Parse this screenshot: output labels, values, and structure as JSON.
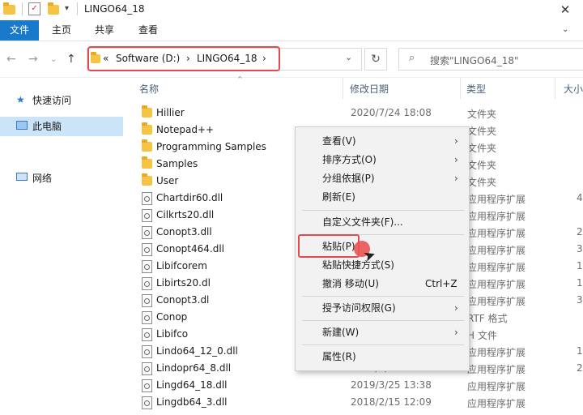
{
  "window": {
    "title": "LINGO64_18",
    "close_glyph": "✕"
  },
  "ribbon": {
    "tabs": [
      "文件",
      "主页",
      "共享",
      "查看"
    ]
  },
  "nav": {
    "back": "←",
    "forward": "→",
    "dropdown": "⌄",
    "up": "↑"
  },
  "address": {
    "prefix": "«",
    "crumbs": [
      "Software (D:)",
      "LINGO64_18"
    ],
    "separator": "›"
  },
  "search": {
    "placeholder": "搜索\"LINGO64_18\""
  },
  "sidebar": {
    "items": [
      {
        "label": "快速访问",
        "icon": "star-icon"
      },
      {
        "label": "此电脑",
        "icon": "computer-icon"
      },
      {
        "label": "网络",
        "icon": "network-icon"
      }
    ]
  },
  "columns": {
    "name": "名称",
    "date": "修改日期",
    "type": "类型",
    "size": "大小"
  },
  "files": [
    {
      "name": "Hillier",
      "date": "2020/7/24 18:08",
      "type": "文件夹",
      "size": "",
      "kind": "folder"
    },
    {
      "name": "Notepad++",
      "date": "",
      "type": "文件夹",
      "size": "",
      "kind": "folder"
    },
    {
      "name": "Programming Samples",
      "date": "",
      "type": "文件夹",
      "size": "",
      "kind": "folder"
    },
    {
      "name": "Samples",
      "date": "",
      "type": "文件夹",
      "size": "",
      "kind": "folder"
    },
    {
      "name": "User",
      "date": "",
      "type": "文件夹",
      "size": "",
      "kind": "folder"
    },
    {
      "name": "Chartdir60.dll",
      "date": "",
      "type": "应用程序扩展",
      "size": "4,",
      "kind": "dll"
    },
    {
      "name": "Cilkrts20.dll",
      "date": "",
      "type": "应用程序扩展",
      "size": "",
      "kind": "dll"
    },
    {
      "name": "Conopt3.dll",
      "date": "",
      "type": "应用程序扩展",
      "size": "2,",
      "kind": "dll"
    },
    {
      "name": "Conopt464.dll",
      "date": "",
      "type": "应用程序扩展",
      "size": "3,",
      "kind": "dll"
    },
    {
      "name": "Libifcorem",
      "date": "",
      "type": "应用程序扩展",
      "size": "1,",
      "kind": "dll"
    },
    {
      "name": "Libirts20.dl",
      "date": "",
      "type": "应用程序扩展",
      "size": "1,",
      "kind": "dll"
    },
    {
      "name": "Conopt3.dl",
      "date": "",
      "type": "应用程序扩展",
      "size": "3,",
      "kind": "dll"
    },
    {
      "name": "Conop",
      "date": "",
      "type": "RTF 格式",
      "size": "",
      "kind": "dll"
    },
    {
      "name": "Libifco",
      "date": "",
      "type": "H 文件",
      "size": "",
      "kind": "dll"
    },
    {
      "name": "Lindo64_12_0.dll",
      "date": "",
      "type": "应用程序扩展",
      "size": "14,",
      "kind": "dll"
    },
    {
      "name": "Lindopr64_8.dll",
      "date": "2018/2/15 11:40",
      "type": "应用程序扩展",
      "size": "2,",
      "kind": "dll"
    },
    {
      "name": "Lingd64_18.dll",
      "date": "2019/3/25 13:38",
      "type": "应用程序扩展",
      "size": "",
      "kind": "dll"
    },
    {
      "name": "Lingdb64_3.dll",
      "date": "2018/2/15 12:09",
      "type": "应用程序扩展",
      "size": "",
      "kind": "dll"
    }
  ],
  "context_menu": {
    "items": [
      {
        "label": "查看(V)",
        "shortcut": "",
        "arrow": "›"
      },
      {
        "label": "排序方式(O)",
        "shortcut": "",
        "arrow": "›"
      },
      {
        "label": "分组依据(P)",
        "shortcut": "",
        "arrow": "›"
      },
      {
        "label": "刷新(E)",
        "shortcut": "",
        "arrow": ""
      },
      {
        "label": "自定义文件夹(F)...",
        "shortcut": "",
        "arrow": ""
      },
      {
        "label": "粘贴(P)",
        "shortcut": "",
        "arrow": ""
      },
      {
        "label": "粘贴快捷方式(S)",
        "shortcut": "",
        "arrow": ""
      },
      {
        "label": "撤消 移动(U)",
        "shortcut": "Ctrl+Z",
        "arrow": ""
      },
      {
        "label": "授予访问权限(G)",
        "shortcut": "",
        "arrow": "›"
      },
      {
        "label": "新建(W)",
        "shortcut": "",
        "arrow": "›"
      },
      {
        "label": "属性(R)",
        "shortcut": "",
        "arrow": ""
      }
    ]
  },
  "colors": {
    "accent": "#1979ca",
    "highlight": "#e5484d",
    "selected_sidebar": "#cce4f7",
    "folder": "#f6c445"
  }
}
